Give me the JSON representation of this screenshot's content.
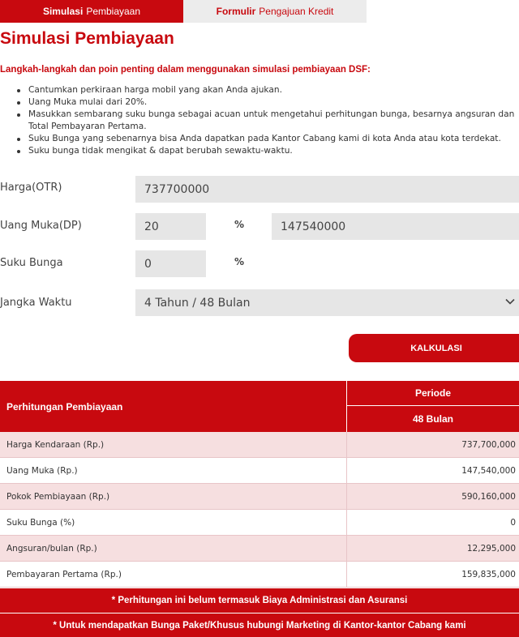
{
  "tabs": {
    "sim_bold": "Simulasi",
    "sim_rest": "Pembiayaan",
    "form_bold": "Formulir",
    "form_rest": "Pengajuan Kredit"
  },
  "title": {
    "bold": "Simulasi",
    "rest": "Pembiayaan"
  },
  "intro": "Langkah-langkah dan poin penting dalam menggunakan simulasi pembiayaan DSF:",
  "steps": [
    "Cantumkan perkiraan harga mobil yang akan Anda ajukan.",
    "Uang Muka mulai dari 20%.",
    "Masukkan sembarang suku bunga sebagai acuan untuk mengetahui perhitungan bunga, besarnya angsuran dan Total Pembayaran Pertama.",
    "Suku Bunga yang sebenarnya bisa Anda dapatkan pada Kantor Cabang kami di kota Anda atau kota terdekat.",
    "Suku bunga tidak mengikat & dapat berubah sewaktu-waktu."
  ],
  "form": {
    "otr_label": "Harga(OTR)",
    "otr_value": "737700000",
    "dp_label": "Uang Muka(DP)",
    "dp_pct_value": "20",
    "pct_sign": "%",
    "dp_amount_value": "147540000",
    "rate_label": "Suku Bunga",
    "rate_value": "0",
    "term_label": "Jangka Waktu",
    "term_value": "4 Tahun / 48 Bulan"
  },
  "calc_button": "KALKULASI",
  "result": {
    "header_label": "Perhitungan Pembiayaan",
    "period_header": "Periode",
    "period_value": "48 Bulan",
    "rows": [
      {
        "label": "Harga Kendaraan (Rp.)",
        "value": "737,700,000"
      },
      {
        "label": "Uang Muka (Rp.)",
        "value": "147,540,000"
      },
      {
        "label": "Pokok Pembiayaan (Rp.)",
        "value": "590,160,000"
      },
      {
        "label": "Suku Bunga (%)",
        "value": "0"
      },
      {
        "label": "Angsuran/bulan (Rp.)",
        "value": "12,295,000"
      },
      {
        "label": "Pembayaran Pertama (Rp.)",
        "value": "159,835,000"
      }
    ],
    "notes": [
      "* Perhitungan ini belum termasuk Biaya Administrasi dan Asuransi",
      "* Untuk mendapatkan Bunga Paket/Khusus hubungi Marketing di Kantor-kantor Cabang kami"
    ]
  },
  "colors": {
    "brand_red": "#c8090f",
    "field_bg": "#e6e6e6",
    "row_tint": "#f6dfe0"
  },
  "icons": {
    "term_dropdown": "chevron-down-icon"
  }
}
